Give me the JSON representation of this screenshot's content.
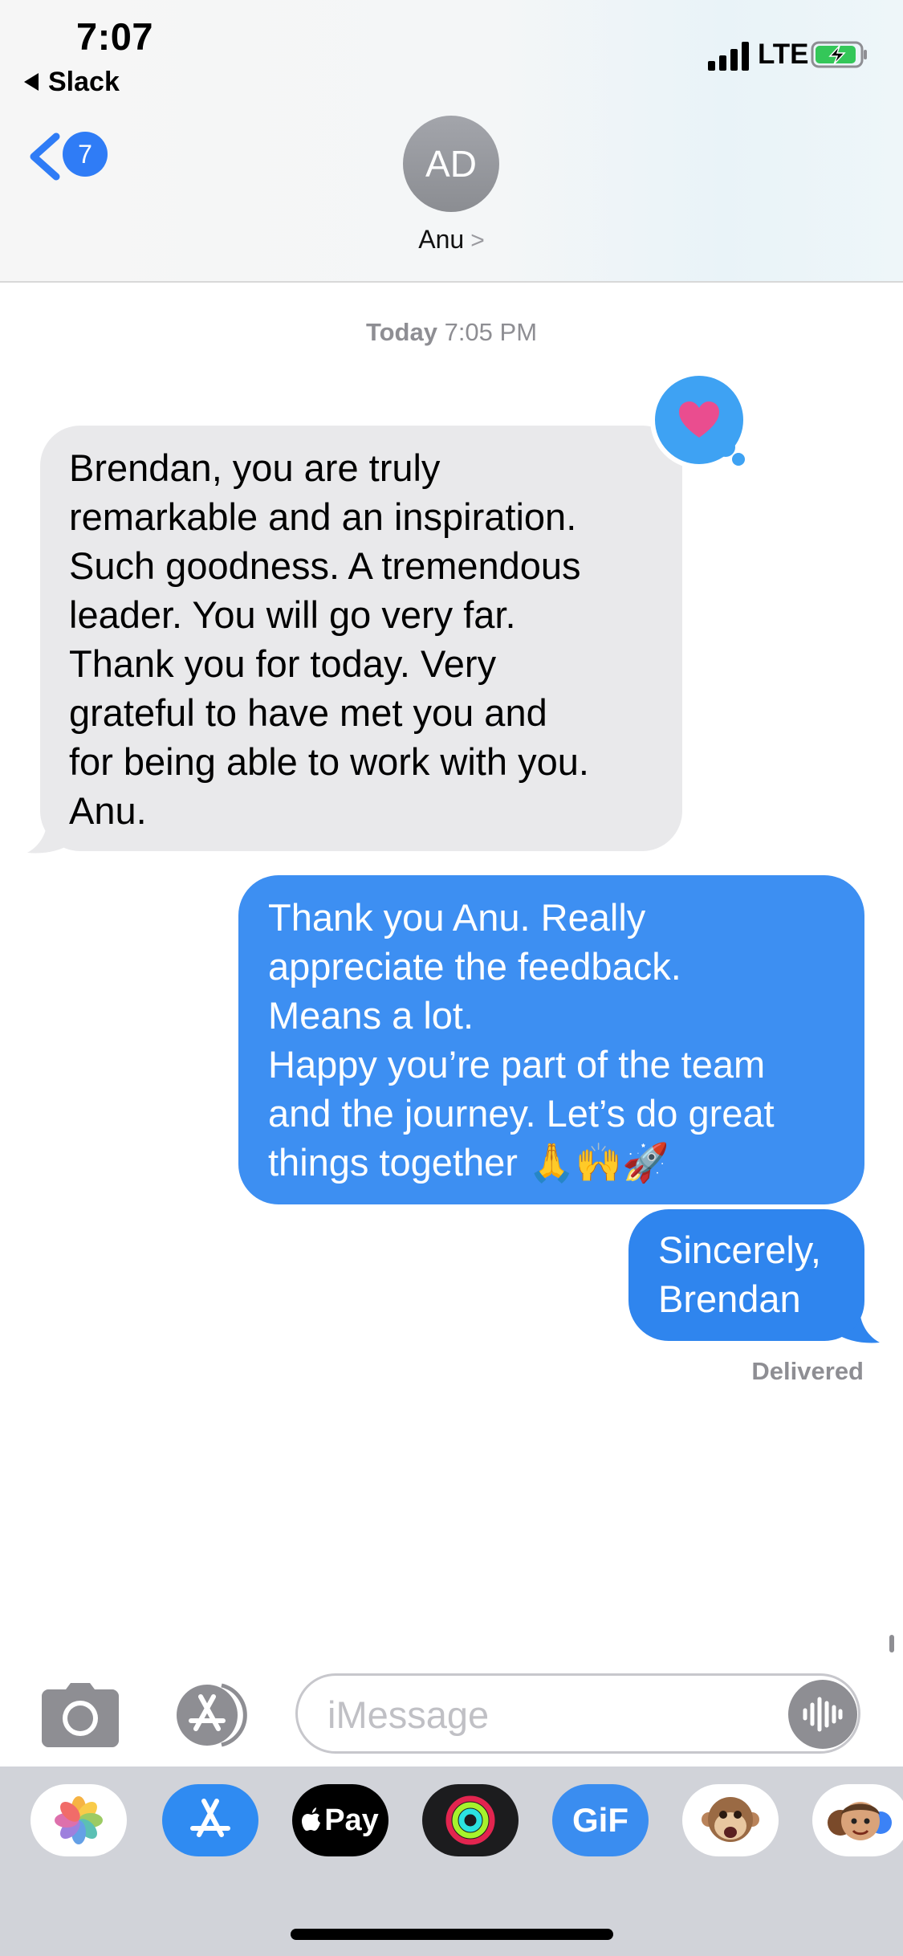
{
  "status_bar": {
    "time": "7:07",
    "back_app": "Slack",
    "network": "LTE"
  },
  "nav": {
    "unread_count": "7",
    "contact_initials": "AD",
    "contact_name": "Anu",
    "contact_chevron": ">"
  },
  "conversation": {
    "timestamp_day": "Today",
    "timestamp_time": "7:05 PM",
    "messages": [
      {
        "direction": "incoming",
        "lines": [
          "Brendan, you are truly",
          "remarkable and an inspiration.",
          "Such goodness. A tremendous",
          "leader. You will go very far.",
          "Thank you for today. Very",
          "grateful to have met you and",
          "for being able to work with you.",
          "Anu."
        ],
        "tapback": "heart-icon"
      },
      {
        "direction": "outgoing",
        "lines": [
          "Thank you Anu. Really",
          "appreciate the feedback.",
          "Means a lot.",
          "Happy you’re part of the team",
          "and the journey. Let’s do great",
          "things together 🙏🙌🚀"
        ]
      },
      {
        "direction": "outgoing",
        "lines": [
          "Sincerely,",
          "Brendan"
        ]
      }
    ],
    "delivery_status": "Delivered"
  },
  "compose": {
    "placeholder": "iMessage"
  },
  "app_drawer": {
    "apple_pay_label": "Pay",
    "gif_label": "GiF",
    "apps": [
      "photos-icon",
      "app-store-icon",
      "apple-pay-icon",
      "activity-icon",
      "gif-icon",
      "monkey-memoji-icon",
      "memoji-icon"
    ]
  },
  "colors": {
    "accent_blue": "#3d8ff2",
    "incoming_bubble": "#e9e9eb",
    "badge_blue": "#2f7cf6",
    "heart_pink": "#ea4d8f"
  }
}
